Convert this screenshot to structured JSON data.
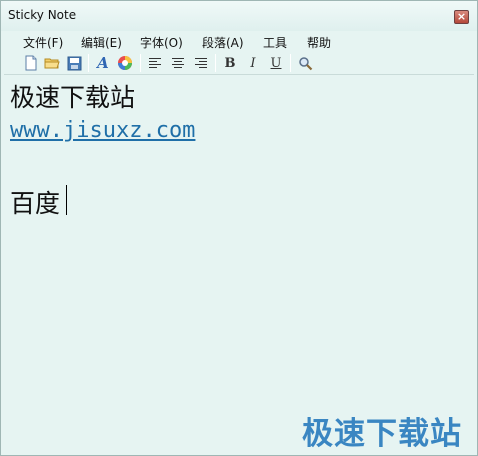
{
  "window": {
    "title": "Sticky Note",
    "close_glyph": "×"
  },
  "menu": {
    "items": [
      {
        "label": "文件(F)"
      },
      {
        "label": "编辑(E)"
      },
      {
        "label": "字体(O)"
      },
      {
        "label": "段落(A)"
      },
      {
        "label": "工具"
      },
      {
        "label": "帮助"
      }
    ]
  },
  "toolbar": {
    "bold_label": "B",
    "italic_label": "I",
    "underline_label": "U",
    "font_label": "A"
  },
  "editor": {
    "lines": [
      "极速下载站",
      "www.jisuxz.com",
      "",
      "百度"
    ]
  },
  "watermark": {
    "text": "极速下载站"
  },
  "colors": {
    "background": "#e6f4f2",
    "link": "#1f6fa8",
    "watermark": "#3a86c2",
    "close_button": "#b4483a"
  }
}
